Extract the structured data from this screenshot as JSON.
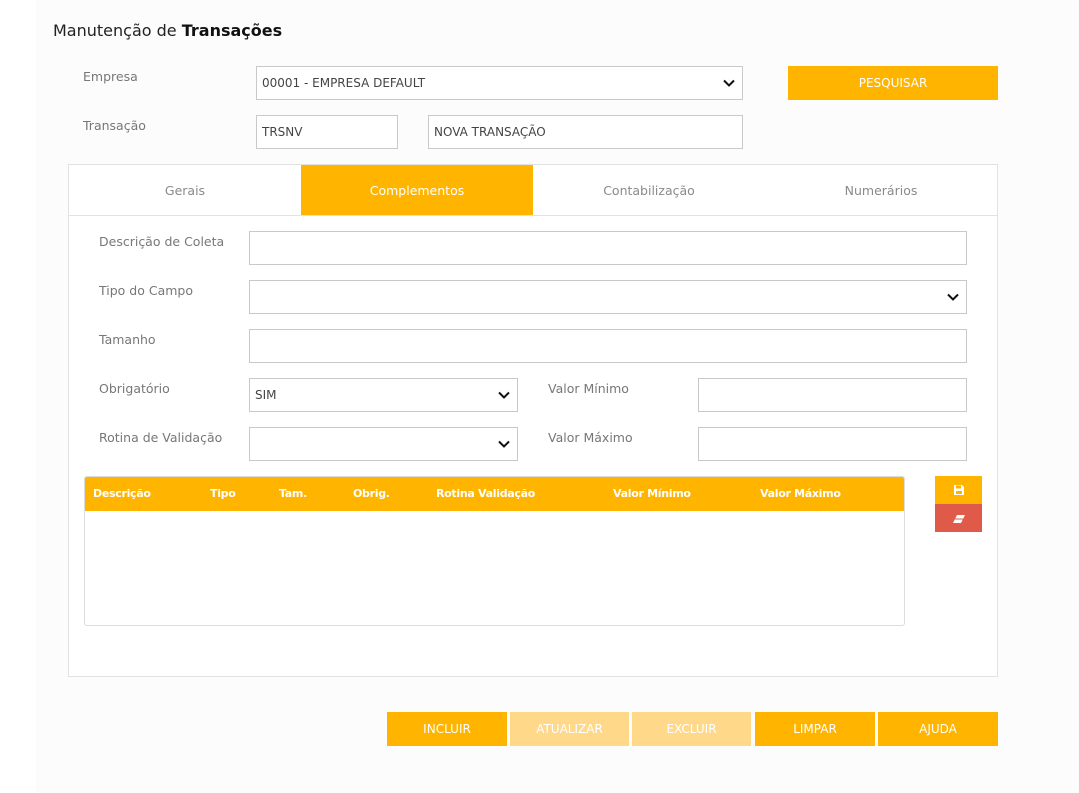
{
  "header": {
    "title_prefix": "Manutenção de ",
    "title_bold": "Transações"
  },
  "form": {
    "empresa_label": "Empresa",
    "empresa_value": "00001 - EMPRESA DEFAULT",
    "pesquisar_label": "PESQUISAR",
    "transacao_label": "Transação",
    "transacao_code": "TRSNV",
    "transacao_desc": "NOVA TRANSAÇÃO"
  },
  "tabs": [
    {
      "label": "Gerais",
      "active": false
    },
    {
      "label": "Complementos",
      "active": true
    },
    {
      "label": "Contabilização",
      "active": false
    },
    {
      "label": "Numerários",
      "active": false
    }
  ],
  "complementos": {
    "descricao_label": "Descrição de Coleta",
    "descricao_value": "",
    "tipo_label": "Tipo do Campo",
    "tipo_value": "",
    "tamanho_label": "Tamanho",
    "tamanho_value": "",
    "obrigatorio_label": "Obrigatório",
    "obrigatorio_value": "SIM",
    "rotina_label": "Rotina de Validação",
    "rotina_value": "",
    "valor_min_label": "Valor Mínimo",
    "valor_min_value": "",
    "valor_max_label": "Valor Máximo",
    "valor_max_value": ""
  },
  "grid": {
    "columns": [
      "Descrição",
      "Tipo",
      "Tam.",
      "Obrig.",
      "Rotina Validação",
      "Valor Mínimo",
      "Valor Máximo"
    ],
    "rows": []
  },
  "actions": {
    "incluir": "INCLUIR",
    "atualizar": "ATUALIZAR",
    "excluir": "EXCLUIR",
    "limpar": "LIMPAR",
    "ajuda": "AJUDA"
  },
  "colors": {
    "accent": "#ffb400",
    "accent_disabled": "#ffd88a",
    "danger": "#e05a4a"
  },
  "icons": {
    "save": "save-icon",
    "eraser": "eraser-icon",
    "dropdown": "chevron-down-icon"
  }
}
